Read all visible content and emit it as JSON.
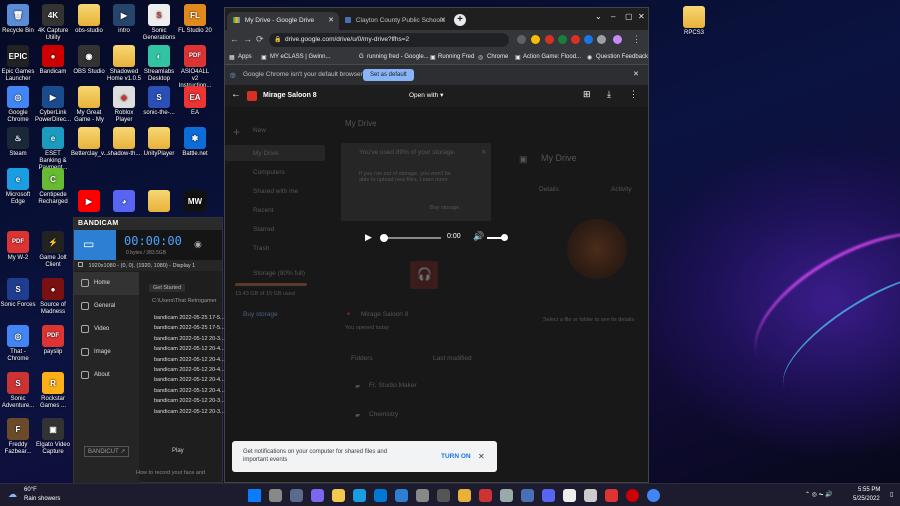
{
  "desktop": {
    "icons": [
      {
        "label": "Recycle Bin",
        "sym": "🗑",
        "c": "#5b8cd6"
      },
      {
        "label": "4K Capture Utility",
        "sym": "4K",
        "c": "#333"
      },
      {
        "label": "obs-studio",
        "sym": "",
        "c": "folder"
      },
      {
        "label": "intro",
        "sym": "▶",
        "c": "#26456b"
      },
      {
        "label": "Sonic Generations",
        "sym": "S",
        "c": "#eee"
      },
      {
        "label": "FL Studio 20",
        "sym": "FL",
        "c": "#e08a1e"
      },
      {
        "label": "Epic Games Launcher",
        "sym": "EPIC",
        "c": "#222"
      },
      {
        "label": "Bandicam",
        "sym": "●",
        "c": "#c00"
      },
      {
        "label": "OBS Studio",
        "sym": "◉",
        "c": "#333"
      },
      {
        "label": "Shadowed Home v1.0.5",
        "sym": "",
        "c": "folder"
      },
      {
        "label": "Streamlabs Desktop",
        "sym": "◐",
        "c": "#31c3a2"
      },
      {
        "label": "ASIO4ALL v2 Instruction...",
        "sym": "PDF",
        "c": "#d33"
      },
      {
        "label": "Google Chrome",
        "sym": "◎",
        "c": "#4285f4"
      },
      {
        "label": "CyberLink PowerDirec...",
        "sym": "▶",
        "c": "#1a4b8c"
      },
      {
        "label": "My Great Game - My ...",
        "sym": "",
        "c": "folder"
      },
      {
        "label": "Roblox Player",
        "sym": "◆",
        "c": "#ddd"
      },
      {
        "label": "sonic-the-...",
        "sym": "S",
        "c": "#2a4fb5"
      },
      {
        "label": "EA",
        "sym": "EA",
        "c": "#e33"
      },
      {
        "label": "Steam",
        "sym": "♨",
        "c": "#1b2838"
      },
      {
        "label": "ESET Banking & Payment...",
        "sym": "e",
        "c": "#1a9bbf"
      },
      {
        "label": "Betterclay_v...",
        "sym": "",
        "c": "folder"
      },
      {
        "label": "shadow-th...",
        "sym": "",
        "c": "folder"
      },
      {
        "label": "UnityPlayer",
        "sym": "",
        "c": "folder"
      },
      {
        "label": "Battle.net",
        "sym": "✱",
        "c": "#0c6cd8"
      },
      {
        "label": "Microsoft Edge",
        "sym": "e",
        "c": "#1b9de2"
      },
      {
        "label": "Centipede Recharged",
        "sym": "C",
        "c": "#6b3"
      },
      {
        "label": "",
        "sym": "▶",
        "c": "#f00"
      },
      {
        "label": "",
        "sym": "◕",
        "c": "#5865f2"
      },
      {
        "label": "",
        "sym": "",
        "c": "folder"
      },
      {
        "label": "",
        "sym": "MW",
        "c": "#111"
      },
      {
        "label": "My W-2",
        "sym": "PDF",
        "c": "#d33"
      },
      {
        "label": "Game Jolt Client",
        "sym": "⚡",
        "c": "#222"
      },
      {
        "label": "Sonic Forces",
        "sym": "S",
        "c": "#1e3d8f"
      },
      {
        "label": "Source of Madness",
        "sym": "●",
        "c": "#7a1010"
      },
      {
        "label": "That - Chrome",
        "sym": "◎",
        "c": "#4285f4"
      },
      {
        "label": "payslip",
        "sym": "PDF",
        "c": "#d33"
      },
      {
        "label": "Sonic Adventure...",
        "sym": "S",
        "c": "#c33"
      },
      {
        "label": "Rockstar Games ...",
        "sym": "R",
        "c": "#fcaf17"
      },
      {
        "label": "Freddy Fazbear...",
        "sym": "F",
        "c": "#6b4a2a"
      },
      {
        "label": "Elgato Video Capture",
        "sym": "▣",
        "c": "#333"
      }
    ],
    "right_icon": {
      "label": "RPCS3"
    }
  },
  "browser": {
    "tabs": [
      {
        "title": "My Drive - Google Drive"
      },
      {
        "title": "Clayton County Public Schools"
      }
    ],
    "address": "drive.google.com/drive/u/0/my-drive?lfhs=2",
    "bookmarks": [
      "Apps",
      "MY eCLASS | Gwinn...",
      "running fred - Google...",
      "Running Fred",
      "Chrome",
      "Action Game: Flood...",
      "Question Feedback"
    ],
    "infobar": {
      "text": "Google Chrome isn't your default browser",
      "button": "Set as default",
      "close": "✕"
    }
  },
  "viewer": {
    "filename": "Mirage Saloon 8",
    "open_with": "Open with",
    "time": "0:00",
    "bg": {
      "my_drive": "My Drive",
      "new": "New",
      "my_drive_side": "My Drive",
      "computers": "Computers",
      "shared": "Shared with me",
      "recent": "Recent",
      "starred": "Starred",
      "trash": "Trash",
      "storage": "Storage (90% full)",
      "storage_used": "13.43 GB of 15 GB used",
      "buy": "Buy storage",
      "warn_title": "You've used 89% of your storage.",
      "warn_body": "If you run out of storage, you won't be able to upload new files. Learn more",
      "buy2": "Buy storage",
      "file_card": "Mirage Saloon 8",
      "file_sub": "You opened today",
      "folders": "Folders",
      "sort": "Last modified",
      "folder1": "Fr. Studio Maker",
      "folder2": "Chemistry",
      "details_title": "My Drive",
      "details_tab": "Details",
      "activity_tab": "Activity",
      "details_hint": "Select a file or folder to see its details"
    },
    "notification": {
      "text": "Get notifications on your computer for shared files and important events",
      "action": "TURN ON"
    }
  },
  "bandicam": {
    "brand": "BANDICAM",
    "timer": "00:00:00",
    "size": "0 bytes / 383.5GB",
    "resolution": "1920x1080 - (0, 0), (1920, 1080) - Display 1",
    "menu": [
      "Home",
      "General",
      "Video",
      "Image",
      "About"
    ],
    "tab": "Get Started",
    "path": "C:\\Users\\That Retrogamer",
    "files": [
      "bandicam 2022-05-25 17-5...",
      "bandicam 2022-05-25 17-5...",
      "bandicam 2022-05-12 20-3...",
      "bandicam 2022-05-12 20-4...",
      "bandicam 2022-05-12 20-4...",
      "bandicam 2022-05-12 20-4...",
      "bandicam 2022-05-12 20-4...",
      "bandicam 2022-05-12 20-4...",
      "bandicam 2022-05-12 20-3...",
      "bandicam 2022-05-12 20-3..."
    ],
    "play": "Play",
    "bandicut": "BANDICUT ↗",
    "footer": "How to record your face and"
  },
  "taskbar": {
    "weather_temp": "60°F",
    "weather_desc": "Rain showers",
    "time": "5:55 PM",
    "date": "5/25/2022"
  }
}
